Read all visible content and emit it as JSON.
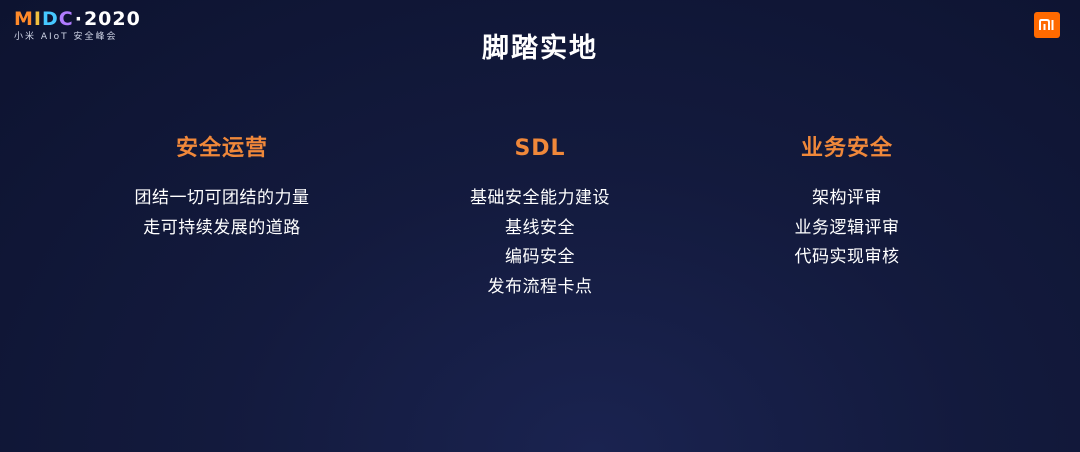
{
  "brand": {
    "name_m": "M",
    "name_i": "I",
    "name_d": "D",
    "name_c": "C",
    "name_dot": "·",
    "name_year": "2020",
    "subtitle": "小米 AIoT 安全峰会",
    "logo_text": "MI",
    "logo_color": "#ff6a00"
  },
  "title": "脚踏实地",
  "columns": [
    {
      "heading": "安全运营",
      "items": [
        "团结一切可团结的力量",
        "走可持续发展的道路"
      ]
    },
    {
      "heading": "SDL",
      "items": [
        "基础安全能力建设",
        "基线安全",
        "编码安全",
        "发布流程卡点"
      ]
    },
    {
      "heading": "业务安全",
      "items": [
        "架构评审",
        "业务逻辑评审",
        "代码实现审核"
      ]
    }
  ],
  "colors": {
    "heading": "#f0883a",
    "background": "#131a3d",
    "text": "#ffffff"
  }
}
